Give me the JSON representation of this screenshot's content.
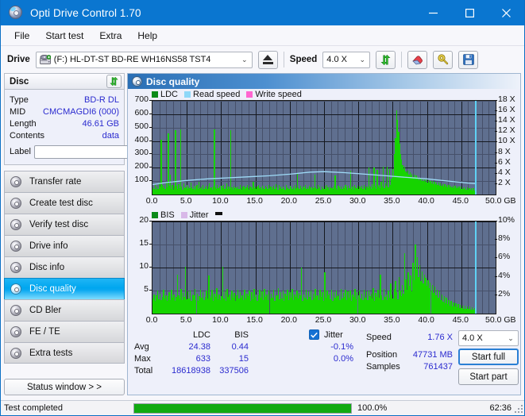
{
  "window": {
    "title": "Opti Drive Control 1.70",
    "icon": "disc-icon",
    "minimize": "–",
    "maximize": "□",
    "close": "✕"
  },
  "menu": {
    "items": [
      "File",
      "Start test",
      "Extra",
      "Help"
    ]
  },
  "toolbar": {
    "drive_label": "Drive",
    "drive_value": "(F:)  HL-DT-ST BD-RE  WH16NS58 TST4",
    "eject_icon": "eject-icon",
    "speed_label": "Speed",
    "speed_value": "4.0 X",
    "refresh_icon": "refresh-icon",
    "erase_icon": "eraser-icon",
    "settings_icon": "settings-icon",
    "save_icon": "save-icon"
  },
  "disc_panel": {
    "header": "Disc",
    "refresh_icon": "refresh-icon",
    "rows": [
      {
        "key": "Type",
        "value": "BD-R DL"
      },
      {
        "key": "MID",
        "value": "CMCMAGDI6 (000)"
      },
      {
        "key": "Length",
        "value": "46.61 GB"
      },
      {
        "key": "Contents",
        "value": "data"
      }
    ],
    "label_key": "Label",
    "label_value": "",
    "label_placeholder": "",
    "disc_button_icon": "cd-icon"
  },
  "nav": {
    "items": [
      {
        "label": "Transfer rate",
        "icon": "disc-icon",
        "active": false
      },
      {
        "label": "Create test disc",
        "icon": "disc-icon",
        "active": false
      },
      {
        "label": "Verify test disc",
        "icon": "disc-icon",
        "active": false
      },
      {
        "label": "Drive info",
        "icon": "disc-icon",
        "active": false
      },
      {
        "label": "Disc info",
        "icon": "disc-icon",
        "active": false
      },
      {
        "label": "Disc quality",
        "icon": "disc-icon",
        "active": true
      },
      {
        "label": "CD Bler",
        "icon": "disc-icon",
        "active": false
      },
      {
        "label": "FE / TE",
        "icon": "disc-icon",
        "active": false
      },
      {
        "label": "Extra tests",
        "icon": "disc-icon",
        "active": false
      }
    ],
    "status_window_button": "Status window > >"
  },
  "main": {
    "header": "Disc quality",
    "header_icon": "disc-icon"
  },
  "chart_data": [
    {
      "type": "bar",
      "id": "ldc-chart",
      "title": "",
      "legend": [
        {
          "label": "LDC",
          "color": "#0a8a18"
        },
        {
          "label": "Read speed",
          "color": "#8ed8f8"
        },
        {
          "label": "Write speed",
          "color": "#ff66d0"
        }
      ],
      "legend_position": "top-left",
      "grid": true,
      "xlabel": "GB",
      "x": [
        0.0,
        5.0,
        10.0,
        15.0,
        20.0,
        25.0,
        30.0,
        35.0,
        40.0,
        45.0,
        50.0
      ],
      "xlim": [
        0,
        50
      ],
      "xtick_labels": [
        "0.0",
        "5.0",
        "10.0",
        "15.0",
        "20.0",
        "25.0",
        "30.0",
        "35.0",
        "40.0",
        "45.0",
        "50.0 GB"
      ],
      "ylabel": "",
      "ylim": [
        0,
        700
      ],
      "ytick_labels": [
        "100",
        "200",
        "300",
        "400",
        "500",
        "600",
        "700"
      ],
      "y2label": "",
      "y2lim": [
        0,
        18
      ],
      "y2tick_labels": [
        "2 X",
        "4 X",
        "6 X",
        "8 X",
        "10 X",
        "12 X",
        "14 X",
        "16 X",
        "18 X"
      ],
      "series": [
        {
          "name": "LDC",
          "color": "#16d400",
          "note": "error-count spikes across 0-47 GB, baseline ~30-90, rising to ~300-630 near 23 GB",
          "values": [
            55,
            42,
            70,
            38,
            60,
            44,
            92,
            58,
            410,
            74,
            48,
            66,
            40,
            90,
            52,
            455,
            68,
            150,
            44,
            72,
            36,
            58,
            482,
            64,
            42,
            76,
            50,
            486,
            60,
            38,
            82,
            46,
            54,
            70,
            40,
            62,
            48,
            88,
            52,
            44,
            66,
            38,
            58,
            74,
            42,
            96,
            50,
            62,
            38,
            70,
            44,
            54,
            68,
            40,
            58,
            84,
            46,
            52,
            36,
            62,
            488,
            54,
            40,
            70,
            46,
            58,
            38,
            64,
            50,
            72,
            42,
            56,
            86,
            40,
            60,
            44,
            478,
            52,
            38,
            68,
            48,
            54,
            40,
            62,
            44,
            74,
            50,
            38,
            58,
            66,
            42,
            52,
            70,
            46,
            38,
            60,
            54,
            44,
            96,
            50,
            62,
            40,
            58,
            72,
            46,
            54,
            38,
            64,
            50,
            42,
            68,
            56,
            40,
            74,
            48,
            60,
            36,
            54,
            66,
            44,
            80,
            52,
            38,
            70,
            46,
            58,
            42,
            62,
            50,
            36,
            74,
            48,
            56,
            40,
            66,
            52,
            44,
            60,
            38,
            70,
            46,
            160,
            54,
            42,
            66,
            50,
            38,
            62,
            48,
            72,
            44,
            56,
            40,
            68,
            52,
            38,
            60,
            46,
            150,
            54,
            40,
            70,
            48,
            62,
            36,
            58,
            50,
            44,
            66,
            40,
            72,
            54,
            38,
            60,
            48,
            56,
            42,
            64,
            140,
            50,
            38,
            68,
            52,
            44,
            58,
            40,
            62,
            48,
            70,
            54,
            38,
            66,
            50,
            180,
            44,
            60,
            38,
            72,
            52,
            46,
            64,
            40,
            58,
            50,
            68,
            42,
            74,
            56,
            38,
            62,
            48,
            204,
            60,
            44,
            78,
            52,
            200,
            66,
            40,
            186,
            58,
            72,
            46,
            94,
            62,
            210,
            50,
            84,
            66,
            206,
            56,
            192,
            70,
            118,
            188,
            140,
            300,
            420,
            630,
            560,
            470,
            380,
            300,
            260,
            220,
            190,
            210,
            170,
            160,
            180,
            150,
            165,
            140,
            155,
            130,
            148,
            125,
            140,
            118,
            132,
            110,
            126,
            104,
            120,
            100,
            115,
            96,
            112,
            92,
            108,
            88,
            104,
            84,
            100,
            80,
            96,
            76,
            92,
            72,
            88,
            68,
            84,
            64,
            80,
            60,
            76,
            58,
            72,
            56,
            70,
            54,
            68,
            52,
            66,
            50,
            64,
            48,
            62,
            46,
            60,
            44,
            58,
            42,
            56,
            40,
            54,
            38,
            52,
            36,
            50,
            34,
            48,
            32,
            46,
            30
          ]
        },
        {
          "name": "Read speed",
          "color": "#9fdcf8",
          "note": "CAV-like read speed curve, starts ~2X, rises to ~4.3X near 23 GB, then declines to ~2X at 47 GB",
          "values_x_gb": [
            0,
            2,
            5,
            8,
            11,
            14,
            17,
            20,
            23,
            25,
            28,
            31,
            34,
            37,
            40,
            43,
            46,
            47
          ],
          "values_speed_x": [
            1.9,
            2.3,
            2.7,
            3.0,
            3.2,
            3.4,
            3.6,
            3.9,
            4.3,
            4.4,
            4.2,
            3.9,
            3.6,
            3.3,
            3.0,
            2.6,
            2.2,
            2.1
          ]
        }
      ],
      "end_marker_gb": 47.0
    },
    {
      "type": "bar",
      "id": "bis-chart",
      "title": "",
      "legend": [
        {
          "label": "BIS",
          "color": "#0a8a18"
        },
        {
          "label": "Jitter",
          "color": "#d8b8e8"
        }
      ],
      "legend_position": "top-left",
      "grid": true,
      "xlabel": "GB",
      "xlim": [
        0,
        50
      ],
      "xtick_labels": [
        "0.0",
        "5.0",
        "10.0",
        "15.0",
        "20.0",
        "25.0",
        "30.0",
        "35.0",
        "40.0",
        "45.0",
        "50.0 GB"
      ],
      "ylim": [
        0,
        20
      ],
      "ytick_labels": [
        "5",
        "10",
        "15",
        "20"
      ],
      "y2lim": [
        0,
        10
      ],
      "y2tick_labels": [
        "2%",
        "4%",
        "6%",
        "8%",
        "10%"
      ],
      "series": [
        {
          "name": "BIS",
          "color": "#16d400",
          "note": "burst indicator subcode errors, baseline ~3-5 rising to ~10-15 near 22-23 GB, ~2 after 30 GB",
          "values": [
            3.2,
            4.1,
            2.8,
            3.9,
            5.0,
            3.1,
            4.4,
            2.9,
            3.6,
            5.1,
            3.3,
            4.0,
            2.7,
            3.8,
            4.6,
            3.0,
            5.2,
            3.4,
            4.2,
            2.8,
            3.7,
            8.5,
            4.0,
            3.2,
            5.3,
            2.9,
            4.5,
            3.6,
            10.2,
            3.1,
            4.8,
            3.3,
            5.0,
            2.8,
            4.1,
            3.9,
            5.4,
            3.0,
            4.3,
            2.7,
            3.8,
            5.1,
            3.4,
            4.6,
            2.9,
            3.6,
            5.0,
            3.2,
            8.2,
            4.0,
            3.5,
            5.2,
            2.8,
            4.4,
            3.7,
            5.5,
            3.1,
            4.2,
            2.9,
            3.8,
            10.1,
            3.3,
            4.9,
            2.7,
            5.3,
            3.6,
            4.1,
            3.0,
            5.0,
            3.4,
            4.5,
            2.8,
            3.9,
            5.1,
            3.2,
            4.7,
            3.5,
            4.0,
            2.9,
            5.2,
            3.3,
            4.3,
            3.8,
            5.0,
            2.7,
            4.6,
            3.1,
            5.4,
            3.6,
            4.2,
            2.8,
            3.9,
            5.1,
            3.4,
            4.8,
            3.0,
            5.3,
            3.7,
            4.1,
            2.9,
            5.0,
            3.2,
            4.4,
            3.5,
            5.2,
            2.8,
            4.0,
            3.9,
            5.5,
            3.1,
            4.6,
            3.3,
            5.0,
            2.7,
            4.3,
            3.8,
            5.1,
            3.0,
            4.7,
            3.4,
            5.3,
            2.9,
            4.1,
            3.6,
            5.0,
            3.2,
            4.5,
            3.9,
            10.0,
            2.8,
            4.2,
            3.5,
            5.2,
            3.1,
            4.8,
            3.7,
            5.0,
            2.9,
            4.4,
            3.3,
            5.4,
            3.8,
            4.0,
            3.0,
            5.1,
            3.6,
            4.6,
            2.8,
            9.0,
            3.4,
            5.0,
            3.9,
            4.3,
            3.1,
            5.2,
            2.7,
            4.7,
            3.5,
            5.0,
            3.8,
            4.1,
            2.9,
            5.3,
            3.2,
            4.5,
            3.6,
            5.1,
            3.0,
            4.9,
            3.4,
            5.0,
            2.8,
            4.2,
            3.7,
            5.4,
            3.1,
            4.6,
            3.9,
            5.0,
            3.3,
            4.4,
            2.9,
            5.2,
            3.5,
            4.8,
            3.0,
            5.0,
            3.8,
            4.3,
            3.2,
            5.5,
            2.8,
            4.5,
            3.6,
            5.1,
            3.4,
            8.5,
            4.0,
            3.0,
            5.3,
            3.7,
            4.2,
            2.9,
            5.0,
            3.5,
            6.5,
            4.1,
            3.3,
            5.4,
            7.0,
            4.6,
            3.1,
            8.0,
            5.0,
            3.8,
            6.2,
            4.4,
            13.1,
            7.5,
            5.2,
            9.0,
            6.0,
            8.2,
            4.8,
            11.0,
            7.2,
            15.0,
            9.5,
            12.2,
            8.0,
            10.5,
            7.0,
            9.2,
            6.5,
            8.5,
            7.8,
            6.0,
            7.2,
            5.5,
            6.8,
            5.0,
            6.2,
            4.5,
            5.8,
            4.0,
            5.2,
            3.5,
            4.8,
            3.0,
            4.2,
            2.6,
            3.8,
            2.3,
            3.4,
            2.0,
            3.0,
            1.8,
            2.7,
            1.6,
            2.4,
            1.5,
            2.2,
            1.4,
            2.0,
            1.3,
            1.9,
            1.2,
            1.8,
            1.1,
            1.7,
            1.0,
            1.6,
            1.0,
            1.5,
            0.9,
            1.4,
            0.9,
            1.3
          ]
        }
      ],
      "end_marker_gb": 47.0
    }
  ],
  "stats": {
    "col_headers": [
      "LDC",
      "BIS"
    ],
    "rows": [
      {
        "label": "Avg",
        "ldc": "24.38",
        "bis": "0.44"
      },
      {
        "label": "Max",
        "ldc": "633",
        "bis": "15"
      },
      {
        "label": "Total",
        "ldc": "18618938",
        "bis": "337506"
      }
    ],
    "jitter": {
      "checkbox_checked": true,
      "label": "Jitter",
      "avg": "-0.1%",
      "max": "0.0%"
    },
    "speed_label": "Speed",
    "speed_value": "1.76 X",
    "position_label": "Position",
    "position_value": "47731 MB",
    "samples_label": "Samples",
    "samples_value": "761437",
    "speed_select": "4.0 X",
    "start_full_button": "Start full",
    "start_part_button": "Start part"
  },
  "statusbar": {
    "text": "Test completed",
    "progress_pct": 100,
    "progress_label": "100.0%",
    "elapsed": "62:36"
  },
  "colors": {
    "accent": "#0a76d0",
    "plot_bg": "#5f6f8f",
    "grid": "#46506a",
    "grid_major": "#15181f",
    "green": "#16d400",
    "read_speed": "#9fdcf8",
    "value_text": "#2b2bcf"
  }
}
